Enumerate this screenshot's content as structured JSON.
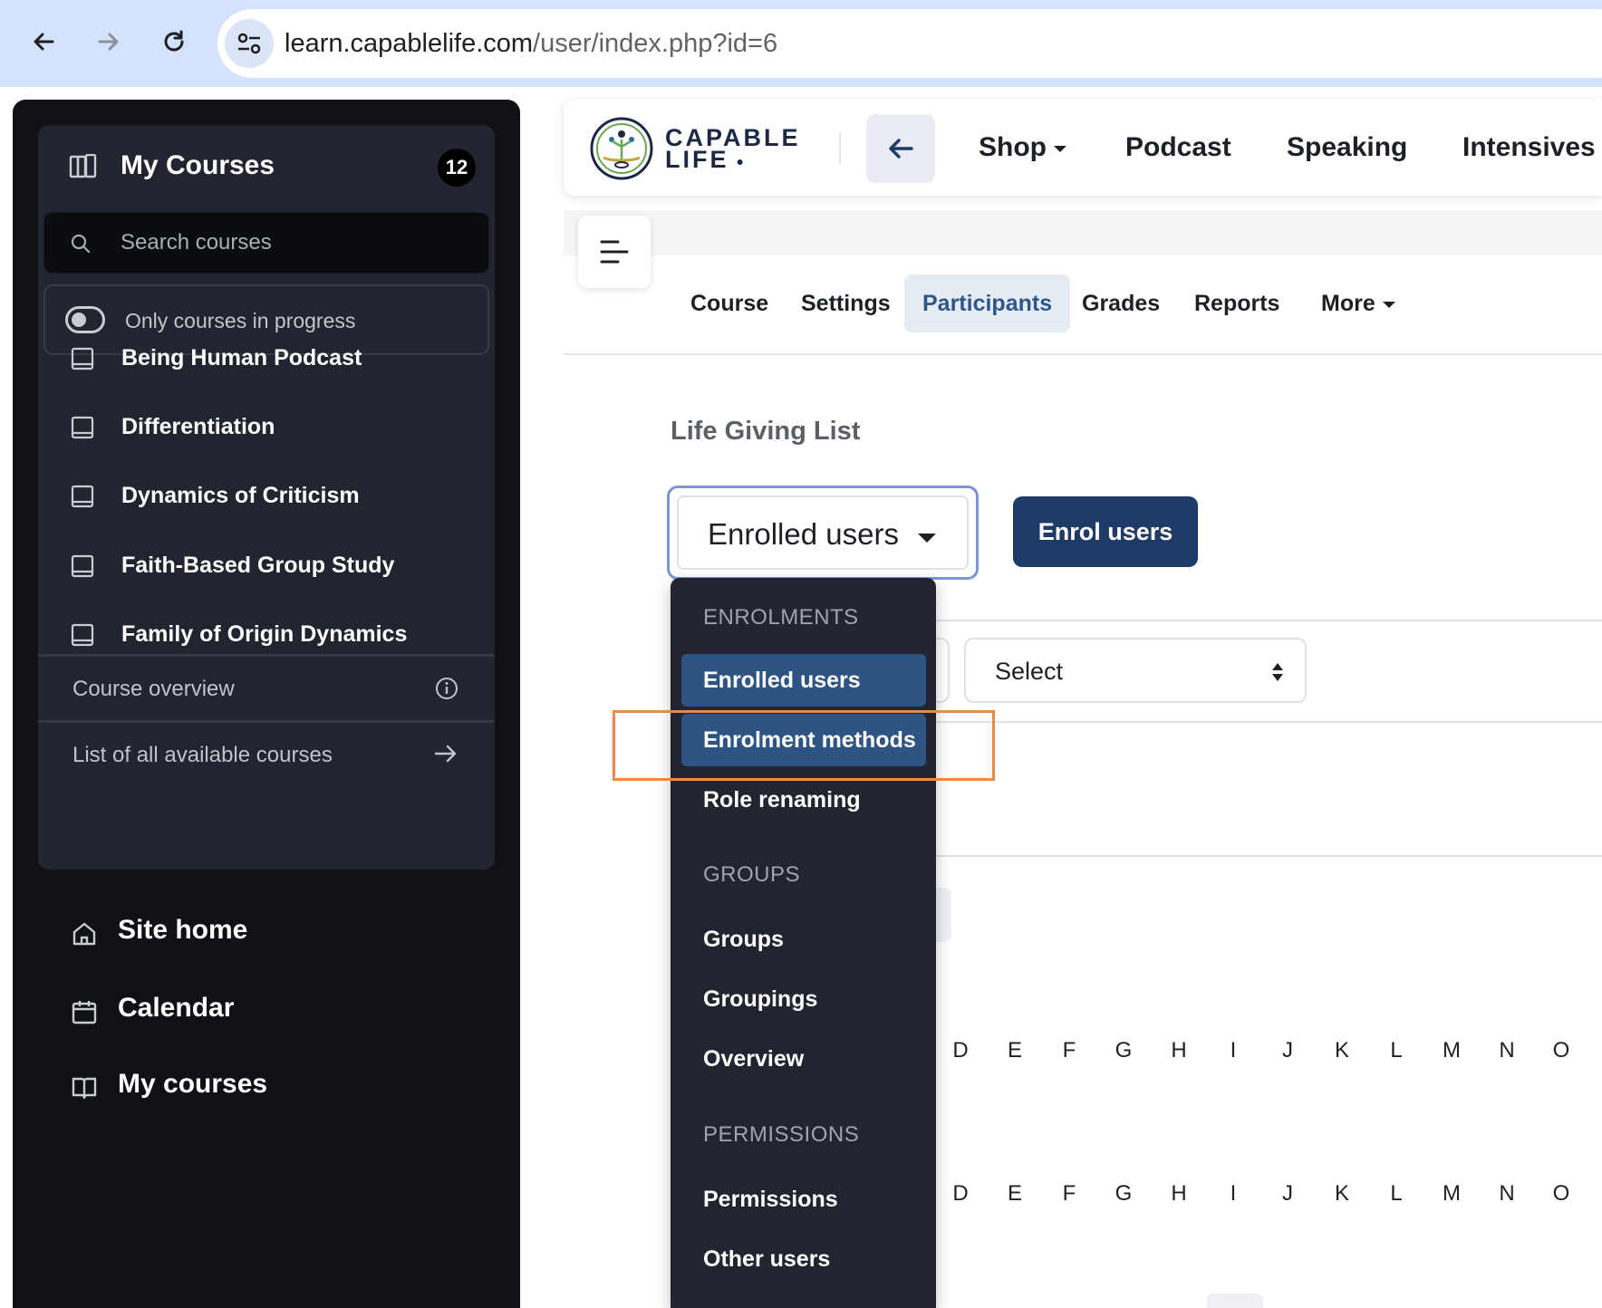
{
  "browser": {
    "url_host": "learn.capablelife.com",
    "url_path": "/user/index.php?id=6"
  },
  "drawer": {
    "title": "My Courses",
    "count": "12",
    "search_placeholder": "Search courses",
    "filter_label": "Only courses in progress",
    "courses": [
      {
        "label": "Being Human Podcast"
      },
      {
        "label": "Differentiation"
      },
      {
        "label": "Dynamics of Criticism"
      },
      {
        "label": "Faith-Based Group Study"
      },
      {
        "label": "Family of Origin Dynamics"
      }
    ],
    "course_overview": "Course overview",
    "all_courses": "List of all available courses",
    "nav": [
      {
        "label": "Site home",
        "icon": "home-icon"
      },
      {
        "label": "Calendar",
        "icon": "calendar-icon"
      },
      {
        "label": "My courses",
        "icon": "book-open-icon"
      }
    ]
  },
  "navbar": {
    "logo_line1": "CAPABLE",
    "logo_line2": "LIFE",
    "links": [
      "Shop",
      "Podcast",
      "Speaking",
      "Intensives"
    ]
  },
  "course_tabs": {
    "items": [
      "Course",
      "Settings",
      "Participants",
      "Grades",
      "Reports",
      "More"
    ],
    "active": "Participants"
  },
  "page": {
    "course_name": "Life Giving List",
    "selected_view": "Enrolled users",
    "enrol_button": "Enrol users",
    "filter_select": "Select",
    "letters": [
      "D",
      "E",
      "F",
      "G",
      "H",
      "I",
      "J",
      "K",
      "L",
      "M",
      "N",
      "O"
    ]
  },
  "dropdown": {
    "sections": [
      {
        "header": "ENROLMENTS",
        "items": [
          "Enrolled users",
          "Enrolment methods",
          "Role renaming"
        ]
      },
      {
        "header": "GROUPS",
        "items": [
          "Groups",
          "Groupings",
          "Overview"
        ]
      },
      {
        "header": "PERMISSIONS",
        "items": [
          "Permissions",
          "Other users"
        ]
      }
    ],
    "selected": "Enrolled users",
    "hovered": "Enrolment methods"
  },
  "colors": {
    "accent": "#1e3a66",
    "active_tab_text": "#2e5688",
    "highlight": "#e98a48",
    "drawer_bg": "#0f1115"
  }
}
